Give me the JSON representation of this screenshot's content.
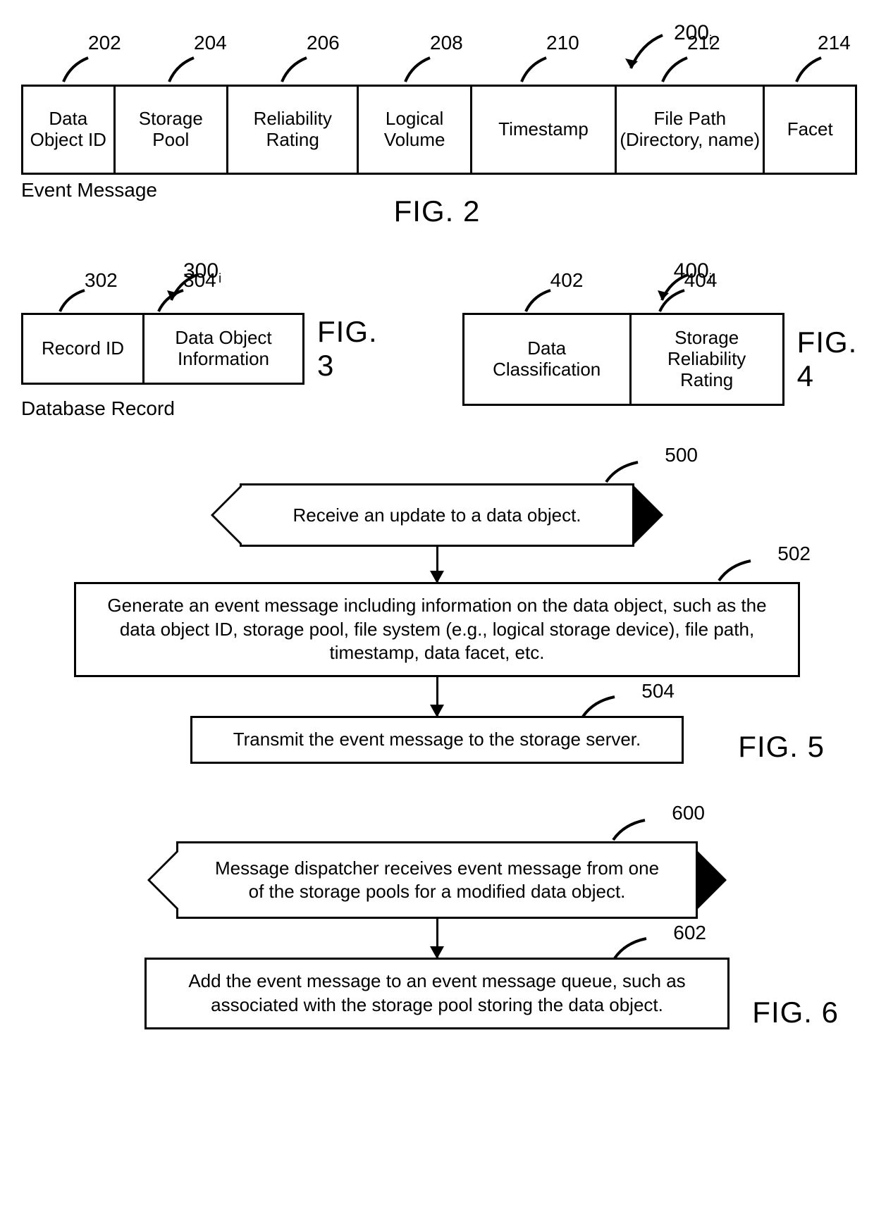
{
  "fig2": {
    "ref": "200",
    "sub": "i",
    "labels": {
      "202": "202",
      "204": "204",
      "206": "206",
      "208": "208",
      "210": "210",
      "212": "212",
      "214": "214"
    },
    "cells": {
      "c202": "Data Object ID",
      "c204": "Storage Pool",
      "c206": "Reliability Rating",
      "c208": "Logical Volume",
      "c210": "Timestamp",
      "c212": "File Path (Directory, name)",
      "c214": "Facet"
    },
    "caption": "Event Message",
    "title": "FIG. 2"
  },
  "fig3": {
    "ref": "300",
    "sub": "i",
    "labels": {
      "302": "302",
      "304": "304"
    },
    "cells": {
      "c302": "Record ID",
      "c304": "Data Object Information"
    },
    "caption": "Database Record",
    "title": "FIG. 3"
  },
  "fig4": {
    "ref": "400",
    "sub": "i",
    "labels": {
      "402": "402",
      "404": "404"
    },
    "cells": {
      "c402": "Data Classification",
      "c404": "Storage Reliability Rating"
    },
    "title": "FIG. 4"
  },
  "fig5": {
    "labels": {
      "500": "500",
      "502": "502",
      "504": "504"
    },
    "steps": {
      "s500": "Receive an update to a data object.",
      "s502": "Generate an event message including information on the data object, such as the data object ID, storage pool, file system (e.g., logical storage device), file path, timestamp, data facet, etc.",
      "s504": "Transmit the event message to the storage server."
    },
    "title": "FIG. 5"
  },
  "fig6": {
    "labels": {
      "600": "600",
      "602": "602"
    },
    "steps": {
      "s600": "Message dispatcher receives event message from one of the storage pools for a modified data object.",
      "s602": "Add the event message to an event message queue, such as associated with the storage pool storing the data object."
    },
    "title": "FIG. 6"
  }
}
